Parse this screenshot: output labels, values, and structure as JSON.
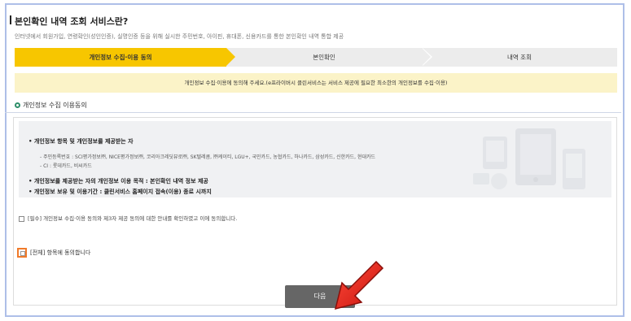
{
  "header": {
    "title": "본인확인 내역 조회 서비스란?",
    "subtitle": "인터넷에서 회원가입, 연령확인(성인인증), 실명인증 등을 위해 실시한 주민번호, 아이핀, 휴대폰, 신용카드를 통한 본인확인 내역 통합 제공"
  },
  "steps": [
    {
      "label": "개인정보 수집·이용 동의",
      "active": true
    },
    {
      "label": "본인확인",
      "active": false
    },
    {
      "label": "내역 조회",
      "active": false
    }
  ],
  "notice": "개인정보 수집·이용에 동의해 주세요.(e프라이버시 클린서비스는 서비스 제공에 필요한 최소한의 개인정보를 수집·이용)",
  "section": {
    "title": "개인정보 수집 이용동의"
  },
  "consent": {
    "item1_title": "개인정보 항목 및 개인정보를 제공받는 자",
    "item1_sub1": "- 주민등록번호 : SCI평가정보㈜, NICE평가정보㈜, 코리아크레딧뷰로㈜, SK텔레콤, ㈜케이티, LGU+, 국민카드, 농협카드, 하나카드, 삼성카드, 신한카드, 현대카드",
    "item1_sub2": "- CI : 롯데카드, 비씨카드",
    "item2": "개인정보를 제공받는 자의 개인정보 이용 목적 : 본인확인 내역 정보 제공",
    "item3": "개인정보 보유 및 이용기간 : 클린서비스 홈페이지 접속(이용) 종료 시까지",
    "agree_required": "[필수] 개인정보 수집·이용 동의와 제3자 제공 동의에 대한 안내를 확인하였고 이에 동의합니다.",
    "agree_all": "[전체] 항목에 동의합니다"
  },
  "buttons": {
    "next": "다음"
  },
  "colors": {
    "active_step": "#f7c600",
    "inactive_step": "#ececec",
    "notice_bg": "#fbf3c8",
    "button_bg": "#666666",
    "highlight": "#f07a2a",
    "arrow": "#e8211b"
  }
}
